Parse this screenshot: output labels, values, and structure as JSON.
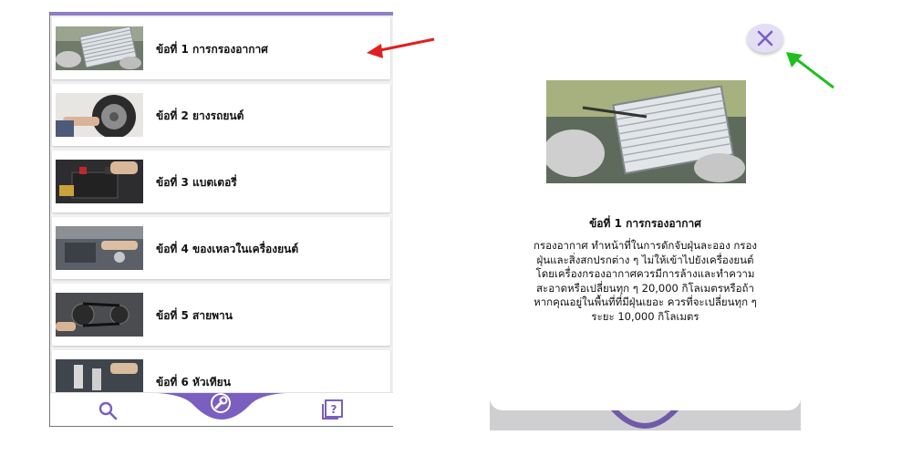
{
  "list": {
    "items": [
      {
        "label": "ข้อที่ 1 การกรองอากาศ",
        "icon": "air-filter-photo"
      },
      {
        "label": "ข้อที่ 2 ยางรถยนต์",
        "icon": "tire-photo"
      },
      {
        "label": "ข้อที่ 3 แบตเตอรี่",
        "icon": "battery-photo"
      },
      {
        "label": "ข้อที่ 4 ของเหลวในเครื่องยนต์",
        "icon": "engine-fluid-photo"
      },
      {
        "label": "ข้อที่ 5 สายพาน",
        "icon": "belt-photo"
      },
      {
        "label": "ข้อที่ 6 หัวเทียน",
        "icon": "spark-plug-photo"
      }
    ]
  },
  "nav": {
    "search_icon": "search-icon",
    "center_icon": "wrench-icon",
    "help_icon": "help-book-icon"
  },
  "dialog": {
    "title": "ข้อที่ 1 การกรองอากาศ",
    "body_lines": [
      "กรองอากาศ ทำหน้าที่ในการดักจับฝุ่นละออง กรอง",
      "ฝุ่นและสิ่งสกปรกต่าง ๆ ไม่ให้เข้าไปยังเครื่องยนต์",
      "โดยเครื่องกรองอากาศควรมีการล้างและทำความ",
      "สะอาดหรือเปลี่ยนทุก ๆ 20,000 กิโลเมตรหรือถ้า",
      "หากคุณอยู่ในพื้นที่ที่มีฝุ่นเยอะ ควรที่จะเปลี่ยนทุก ๆ",
      "ระยะ 10,000 กิโลเมตร"
    ],
    "close_icon": "close-icon"
  },
  "colors": {
    "accent": "#7b5fc0",
    "accent_light": "#e4def5",
    "red_arrow": "#e02020",
    "green_arrow": "#1fbf1f"
  }
}
